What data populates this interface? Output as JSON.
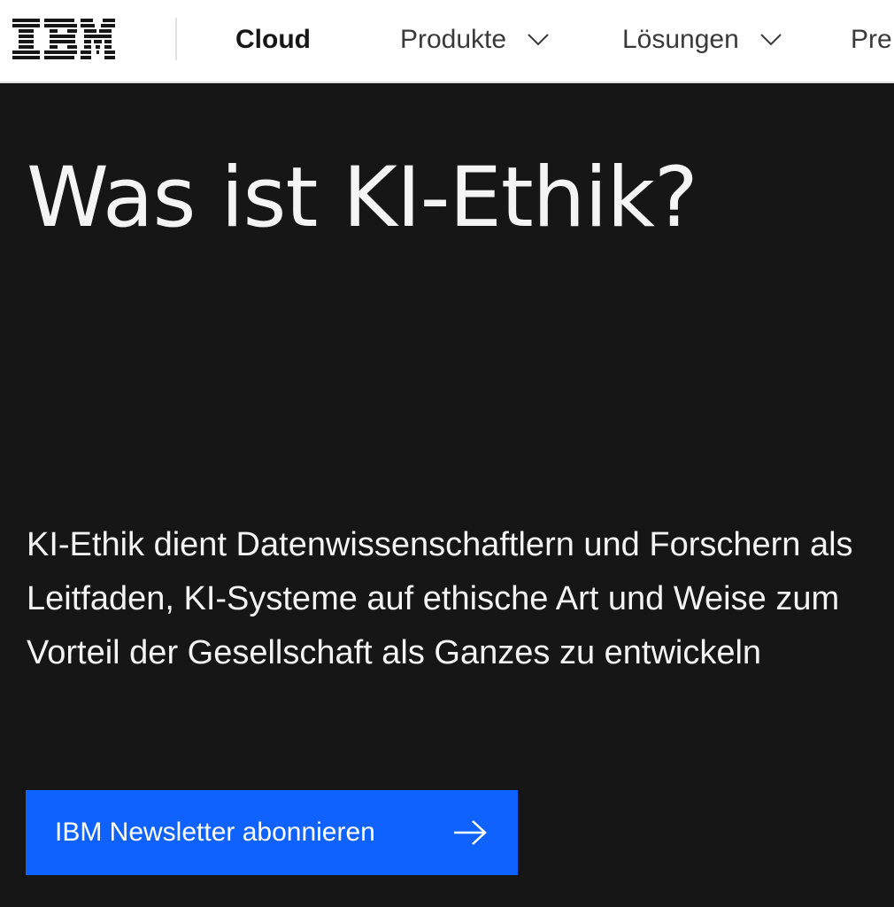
{
  "header": {
    "logo_text": "IBM",
    "brand": "Cloud",
    "nav_items": [
      {
        "label": "Produkte",
        "icon": "chevron-down-icon"
      },
      {
        "label": "Lösungen",
        "icon": "chevron-down-icon"
      },
      {
        "label": "Pre"
      }
    ]
  },
  "hero": {
    "title": "Was ist KI-Ethik?",
    "description": "KI-Ethik dient Datenwissenschaftlern und Forschern als Leitfaden, KI-Systeme auf ethische Art und Weise zum Vorteil der Gesellschaft als Ganzes zu entwickeln",
    "cta": {
      "label": "IBM Newsletter abonnieren",
      "icon": "arrow-right-icon"
    }
  },
  "colors": {
    "hero_background": "#161616",
    "header_background": "#ffffff",
    "cta_background": "#0f62fe",
    "text_light": "#f4f4f4"
  }
}
